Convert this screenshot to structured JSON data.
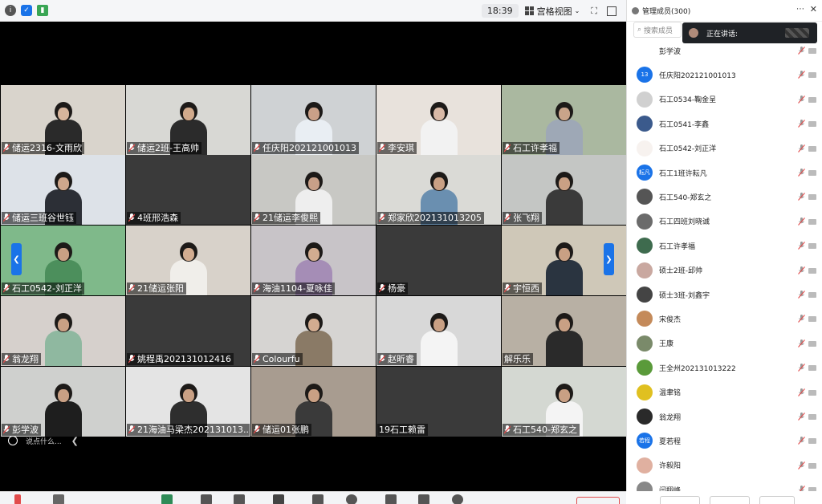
{
  "topbar": {
    "time": "18:39",
    "view_label": "宫格视图"
  },
  "panel": {
    "title": "管理成员(300)",
    "search_placeholder": "搜索成员",
    "speaking_label": "正在讲话:",
    "members": [
      {
        "name": "彭学波",
        "avatar": "",
        "color": "#ffffff"
      },
      {
        "name": "任庆阳202121001013",
        "avatar": "13",
        "color": "#1a73e8"
      },
      {
        "name": "石工0534-鞠金呈",
        "avatar": "",
        "color": "#d0d0d0"
      },
      {
        "name": "石工0541-李鑫",
        "avatar": "",
        "color": "#3b5a8c"
      },
      {
        "name": "石工0542-刘正洋",
        "avatar": "",
        "color": "#f7f2ef"
      },
      {
        "name": "石工1班许耘凡",
        "avatar": "耘凡",
        "color": "#1a73e8"
      },
      {
        "name": "石工540-郑玄之",
        "avatar": "",
        "color": "#555555"
      },
      {
        "name": "石工四班刘晓诚",
        "avatar": "",
        "color": "#6b6b6b"
      },
      {
        "name": "石工许孝福",
        "avatar": "",
        "color": "#3e6b4e"
      },
      {
        "name": "硕士2班-邱帅",
        "avatar": "",
        "color": "#c9a8a0"
      },
      {
        "name": "硕士3班-刘鑫宇",
        "avatar": "",
        "color": "#444444"
      },
      {
        "name": "宋俊杰",
        "avatar": "",
        "color": "#c48a5a"
      },
      {
        "name": "王康",
        "avatar": "",
        "color": "#7a8a6a"
      },
      {
        "name": "王全州202131013222",
        "avatar": "",
        "color": "#5a9a3a"
      },
      {
        "name": "温聿铭",
        "avatar": "",
        "color": "#e0c020"
      },
      {
        "name": "翁龙翔",
        "avatar": "",
        "color": "#2a2a2a"
      },
      {
        "name": "夏若程",
        "avatar": "若程",
        "color": "#1a73e8"
      },
      {
        "name": "许毅阳",
        "avatar": "",
        "color": "#e0b0a0"
      },
      {
        "name": "闫翔峰",
        "avatar": "",
        "color": "#888888"
      }
    ]
  },
  "tiles": [
    {
      "name": "储运2316-文雨欣",
      "bg": "#d9d4cc",
      "shirt": "#2a2a2a",
      "skin": "#d7b59c"
    },
    {
      "name": "储运2班-王高帅",
      "bg": "#d8d8d4",
      "shirt": "#2b2b2b",
      "skin": "#d1aa8c"
    },
    {
      "name": "任庆阳202121001013",
      "bg": "#cfd2d4",
      "shirt": "#e9eef3",
      "skin": "#caa088"
    },
    {
      "name": "李安琪",
      "bg": "#e8e2dc",
      "shirt": "#f2f2f2",
      "skin": "#d9b9a6"
    },
    {
      "name": "石工许孝福",
      "bg": "#aab8a0",
      "shirt": "#9ea8b6",
      "skin": "#c9a48a"
    },
    {
      "name": "储运三班谷世钰",
      "bg": "#dde2e8",
      "shirt": "#2c2f36",
      "skin": "#cfa78c"
    },
    {
      "name": "4班邢浩森",
      "bg": "#3a3a3a",
      "shirt": "",
      "skin": ""
    },
    {
      "name": "21储运李俊熙",
      "bg": "#c8c8c4",
      "shirt": "#eeeeee",
      "skin": "#c8a088"
    },
    {
      "name": "郑家欣202131013205",
      "bg": "#dadad6",
      "shirt": "#6a8fb0",
      "skin": "#c9a084"
    },
    {
      "name": "张飞翔",
      "bg": "#c4c6c4",
      "shirt": "#3a3a3a",
      "skin": "#c9a084"
    },
    {
      "name": "石工0542-刘正洋",
      "bg": "#7fb98a",
      "shirt": "#4c8f5c",
      "skin": "#c9a084"
    },
    {
      "name": "21储运张阳",
      "bg": "#d8d2ca",
      "shirt": "#f0eeea",
      "skin": "#d2ac90"
    },
    {
      "name": "海油1104-夏咏佳",
      "bg": "#c8c4c8",
      "shirt": "#a58db6",
      "skin": "#d2ac90"
    },
    {
      "name": "杨豪",
      "bg": "#3a3a3a",
      "shirt": "",
      "skin": ""
    },
    {
      "name": "宇恒西",
      "bg": "#cfc8b8",
      "shirt": "#2a3440",
      "skin": "#c9a084"
    },
    {
      "name": "翁龙翔",
      "bg": "#d6d0cc",
      "shirt": "#8fb8a0",
      "skin": "#c9a084"
    },
    {
      "name": "姚程禹202131012416",
      "bg": "#3a3a3a",
      "shirt": "",
      "skin": ""
    },
    {
      "name": "Colourfu",
      "bg": "#d6d4d2",
      "shirt": "#8a7a66",
      "skin": "#d2ac90"
    },
    {
      "name": "赵昕睿",
      "bg": "#d8d8d8",
      "shirt": "#f4f4f4",
      "skin": "#c9a084"
    },
    {
      "name": "解乐乐",
      "bg": "#b8b0a4",
      "shirt": "#2a2a2a",
      "skin": "#c9a084"
    },
    {
      "name": "彭学波",
      "bg": "#cfd0ce",
      "shirt": "#1e1e1e",
      "skin": "#c9a084"
    },
    {
      "name": "21海油马梁杰202131013...",
      "bg": "#e4e4e4",
      "shirt": "#2e2e2e",
      "skin": "#c9a084"
    },
    {
      "name": "储运01张鹏",
      "bg": "#a89c90",
      "shirt": "#3a3a3a",
      "skin": "#c9a084"
    },
    {
      "name": "19石工赖雷",
      "bg": "#3a3a3a",
      "shirt": "",
      "skin": ""
    },
    {
      "name": "石工540-郑玄之",
      "bg": "#d4d8d2",
      "shirt": "#f4f4f4",
      "skin": "#c9a084"
    }
  ],
  "chat": {
    "placeholder": "说点什么..."
  }
}
